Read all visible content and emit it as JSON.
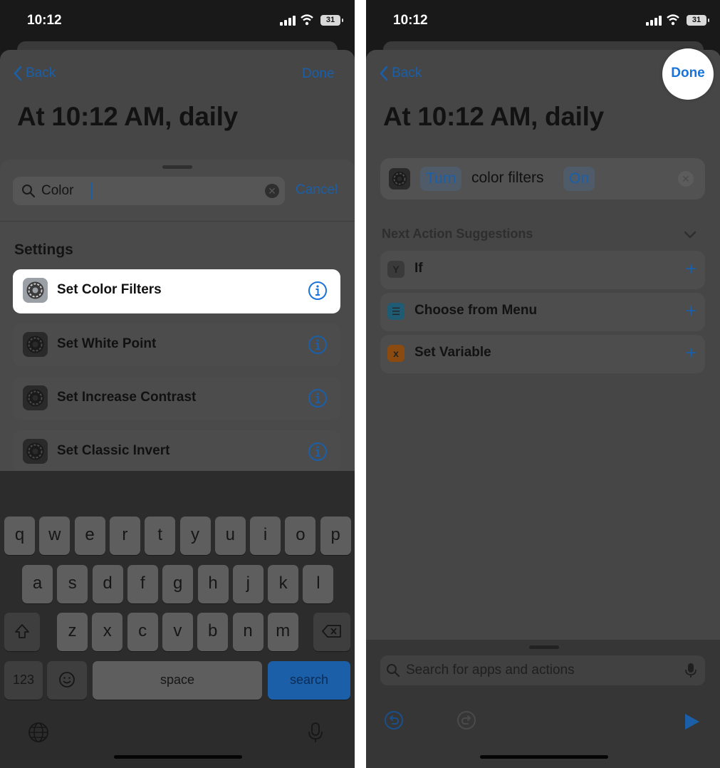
{
  "left": {
    "status": {
      "time": "10:12",
      "battery": "31"
    },
    "nav": {
      "back": "Back",
      "done": "Done"
    },
    "title": "At 10:12 AM, daily",
    "search": {
      "query": "Color",
      "cancel": "Cancel"
    },
    "section": "Settings",
    "results": [
      {
        "label": "Set Color Filters",
        "highlighted": true
      },
      {
        "label": "Set White Point",
        "highlighted": false
      },
      {
        "label": "Set Increase Contrast",
        "highlighted": false
      },
      {
        "label": "Set Classic Invert",
        "highlighted": false
      }
    ],
    "keyboard": {
      "row1": [
        "q",
        "w",
        "e",
        "r",
        "t",
        "y",
        "u",
        "i",
        "o",
        "p"
      ],
      "row2": [
        "a",
        "s",
        "d",
        "f",
        "g",
        "h",
        "j",
        "k",
        "l"
      ],
      "row3": [
        "z",
        "x",
        "c",
        "v",
        "b",
        "n",
        "m"
      ],
      "numbers": "123",
      "space": "space",
      "search": "search"
    }
  },
  "right": {
    "status": {
      "time": "10:12",
      "battery": "31"
    },
    "nav": {
      "back": "Back",
      "done": "Done"
    },
    "title": "At 10:12 AM, daily",
    "action": {
      "verb": "Turn",
      "object": "color filters",
      "state": "On"
    },
    "suggestions": {
      "header": "Next Action Suggestions",
      "items": [
        {
          "label": "If",
          "icon": "Y",
          "color": "#3a3a3a"
        },
        {
          "label": "Choose from Menu",
          "icon": "☰",
          "color": "#1f5c73"
        },
        {
          "label": "Set Variable",
          "icon": "x",
          "color": "#8a4a10"
        }
      ]
    },
    "search_placeholder": "Search for apps and actions"
  },
  "colors": {
    "accent": "#1a5fa8",
    "spotlight_text": "#1a73d6"
  }
}
